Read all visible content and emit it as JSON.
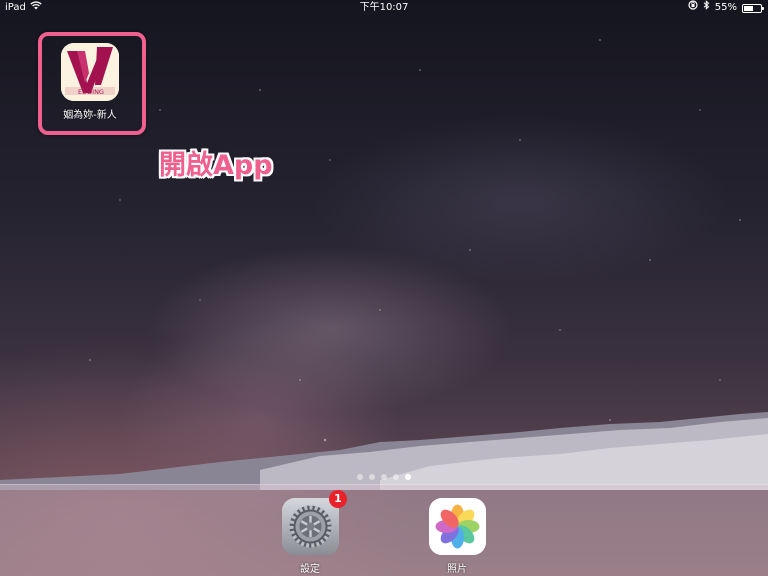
{
  "status_bar": {
    "device": "iPad",
    "time": "下午10:07",
    "battery_percent_label": "55%",
    "battery_level": 0.55
  },
  "home": {
    "apps": [
      {
        "label": "姻為妳-新人",
        "icon": "wedding-app-icon",
        "logo_text": "EDDING"
      }
    ],
    "callout": "開啟App",
    "highlight_color": "#f0608f",
    "pages": {
      "count": 5,
      "active_index": 4
    }
  },
  "dock": {
    "apps": [
      {
        "label": "設定",
        "icon": "settings-gear-icon",
        "badge": "1"
      },
      {
        "label": "照片",
        "icon": "photos-flower-icon"
      }
    ]
  }
}
